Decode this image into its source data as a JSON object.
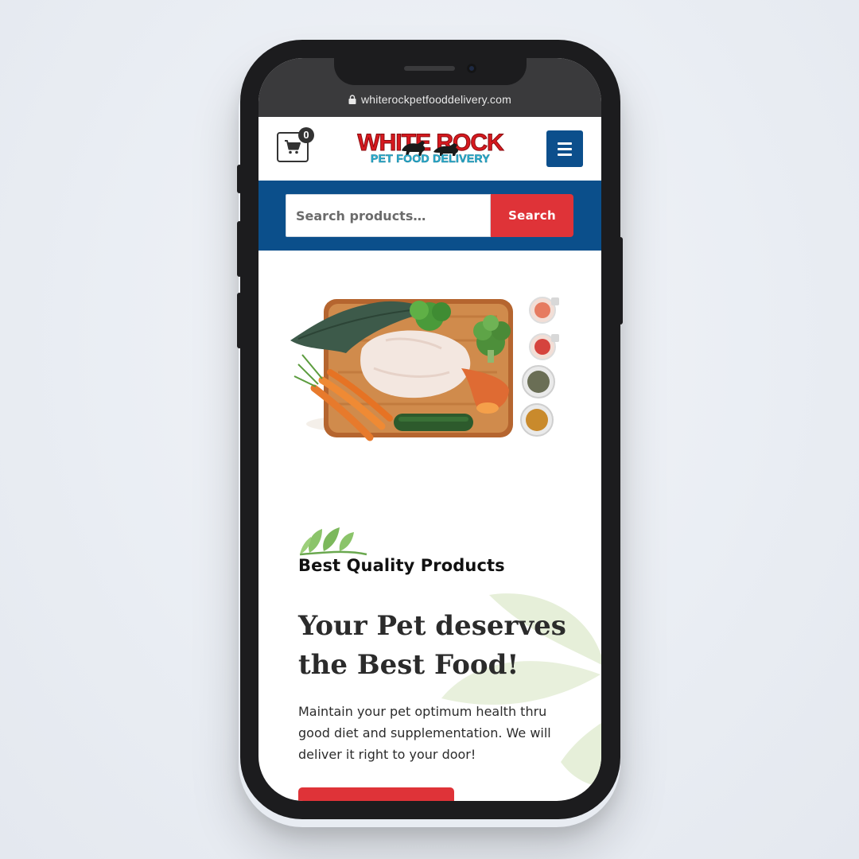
{
  "browser": {
    "url": "whiterockpetfooddelivery.com"
  },
  "header": {
    "cart_count": "0",
    "logo_line1": "WHITE ROCK",
    "logo_line2": "PET FOOD DELIVERY"
  },
  "search": {
    "placeholder": "Search products…",
    "button_label": "Search"
  },
  "hero": {
    "kicker": "Best Quality Products",
    "headline": "Your Pet deserves the Best Food!",
    "body": "Maintain your pet optimum health thru good diet and supplementation. We will deliver it right to your door!"
  },
  "colors": {
    "brand_blue": "#0b4f8b",
    "accent_red": "#df3338",
    "logo_cyan": "#2bb3d6",
    "phone_frame": "#1c1c1e"
  },
  "icons": [
    "lock-icon",
    "cart-icon",
    "hamburger-menu-icon",
    "herb-sprig-icon"
  ]
}
